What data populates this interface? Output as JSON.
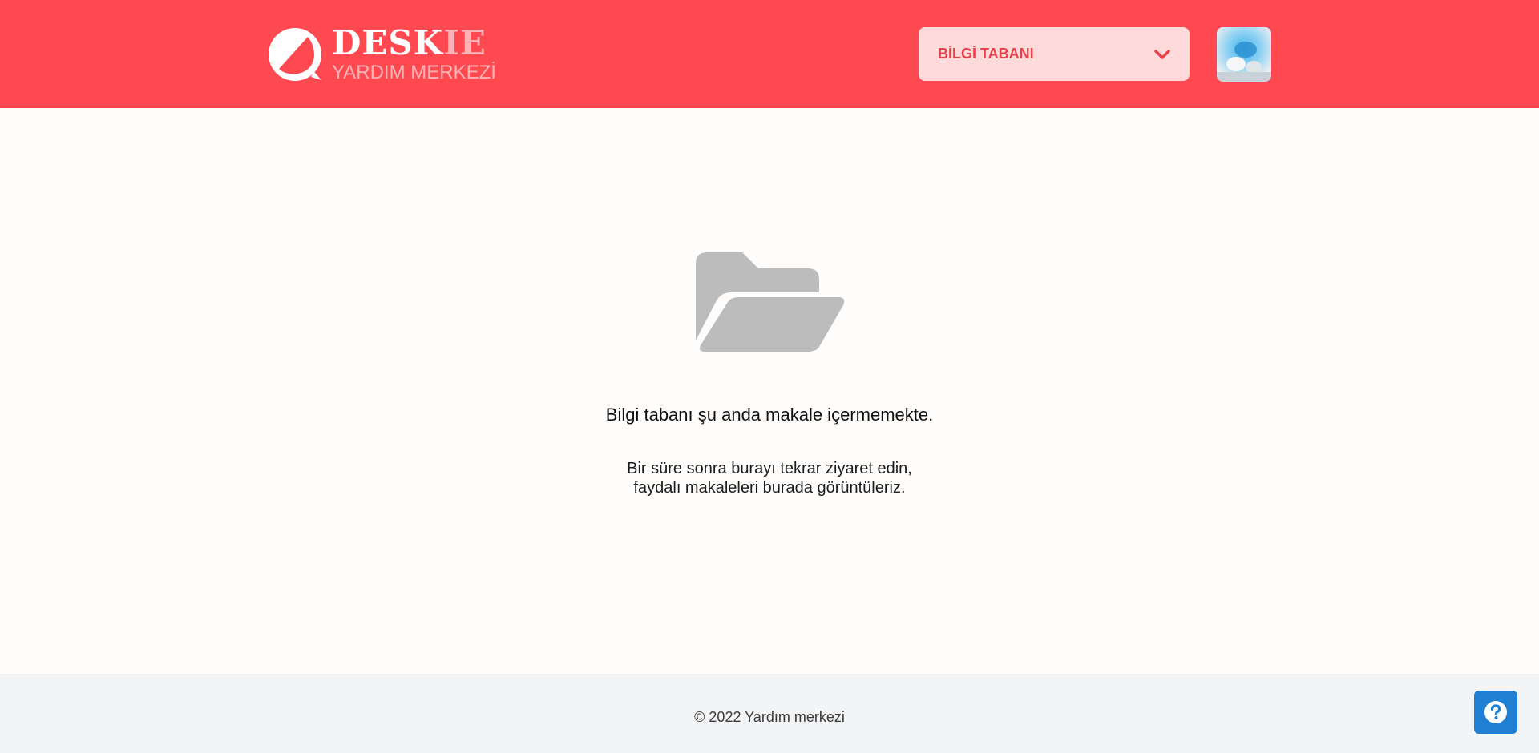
{
  "header": {
    "brand": {
      "name_main": "DESK",
      "name_accent": "IE",
      "subtitle": "YARDIM MERKEZİ",
      "logo_icon": "chat-bubble-logo-icon"
    },
    "kb_select": {
      "selected": "BİLGİ TABANI",
      "icon": "chevron-down-icon"
    },
    "avatar_icon": "user-avatar"
  },
  "empty_state": {
    "icon": "folder-open-icon",
    "title": "Bilgi tabanı şu anda makale içermemekte.",
    "line1": "Bir süre sonra burayı tekrar ziyaret edin,",
    "line2": "faydalı makaleleri burada görüntüleriz."
  },
  "footer": {
    "copyright": "© 2022 Yardım merkezi"
  },
  "help_button": {
    "icon": "question-circle-icon"
  },
  "colors": {
    "header_bg": "#ff4951",
    "accent_light": "#ffb3b7",
    "select_bg": "#ffdadb",
    "select_text": "#e8414a",
    "folder_gray": "#bcbcbc",
    "footer_bg": "#f3f4f6",
    "help_bg": "#1f7fd2"
  }
}
